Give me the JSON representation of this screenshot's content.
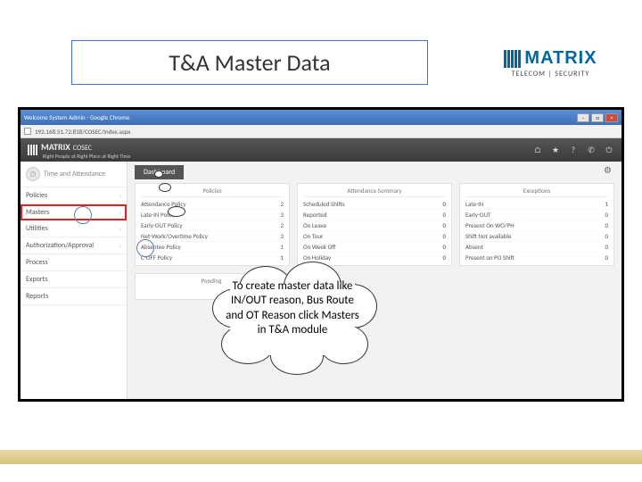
{
  "slide_title": "T&A Master Data",
  "matrix_brand": "MATRIX",
  "matrix_tagline": "TELECOM | SECURITY",
  "browser": {
    "chrome_tab": "Welcome System Admin - Google Chrome",
    "url": "192.168.51.72:818/COSEC/Index.aspx"
  },
  "app_header": {
    "brand": "MATRIX",
    "product": "COSEC",
    "tagline": "Right People at Right Place at Right Time"
  },
  "sidebar": {
    "module_title": "Time and Attendance",
    "items": [
      "Policies",
      "Masters",
      "Utilities",
      "Authorization/Approval",
      "Process",
      "Exports",
      "Reports"
    ]
  },
  "dashboard": {
    "tab_label": "Dashboard",
    "cards": {
      "policies": {
        "title": "Policies",
        "rows": [
          {
            "label": "Attendance Policy",
            "value": "2"
          },
          {
            "label": "Late-IN Policy",
            "value": "3"
          },
          {
            "label": "Early-OUT Policy",
            "value": "2"
          },
          {
            "label": "Net-Work/Overtime Policy",
            "value": "3"
          },
          {
            "label": "Absentee Policy",
            "value": "1"
          },
          {
            "label": "C-OFF Policy",
            "value": "1"
          }
        ]
      },
      "attendance": {
        "title": "Attendance Summary",
        "rows": [
          {
            "label": "Scheduled Shifts",
            "value": "0"
          },
          {
            "label": "Reported",
            "value": "0"
          },
          {
            "label": "On Leave",
            "value": "0"
          },
          {
            "label": "On Tour",
            "value": "0"
          },
          {
            "label": "On Week Off",
            "value": "0"
          },
          {
            "label": "On Holiday",
            "value": "0"
          }
        ]
      },
      "exceptions": {
        "title": "Exceptions",
        "rows": [
          {
            "label": "Late-IN",
            "value": "1"
          },
          {
            "label": "Early-OUT",
            "value": "0"
          },
          {
            "label": "Present On WO/PH",
            "value": "0"
          },
          {
            "label": "Shift Not available",
            "value": "0"
          },
          {
            "label": "Absent",
            "value": "0"
          },
          {
            "label": "Present on PO Shift",
            "value": "0"
          }
        ]
      }
    },
    "pending_title": "Pending"
  },
  "callout_text": "To create master data like IN/OUT reason, Bus Route and OT Reason click Masters in T&A module"
}
